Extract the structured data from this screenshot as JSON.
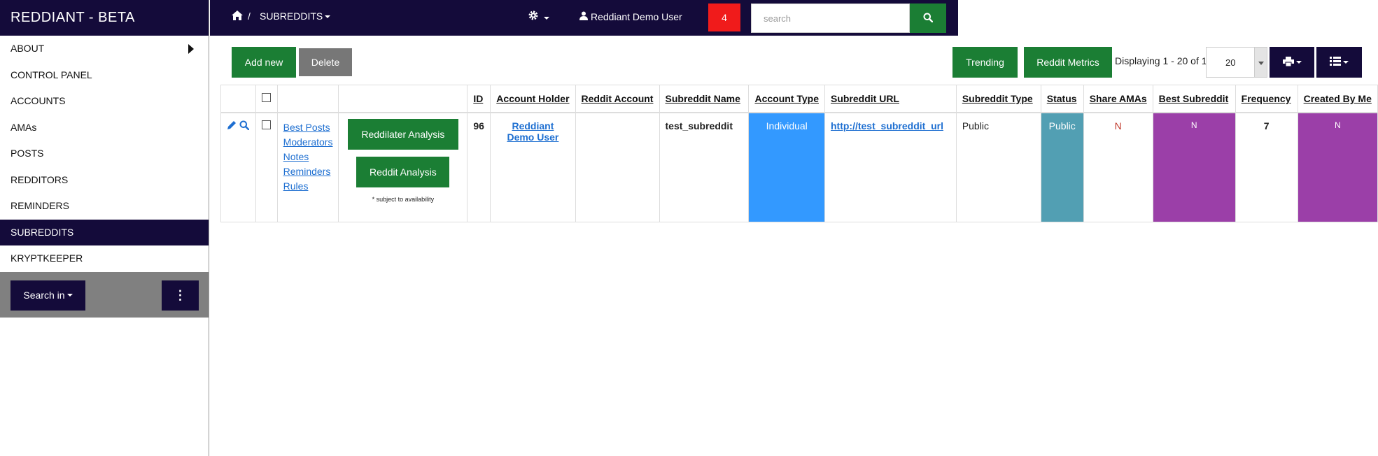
{
  "app": {
    "title": "REDDIANT - BETA"
  },
  "sidebar": {
    "items": [
      {
        "label": "ABOUT"
      },
      {
        "label": "CONTROL PANEL"
      },
      {
        "label": "ACCOUNTS"
      },
      {
        "label": "AMAs"
      },
      {
        "label": "POSTS"
      },
      {
        "label": "REDDITORS"
      },
      {
        "label": "REMINDERS"
      },
      {
        "label": "SUBREDDITS"
      },
      {
        "label": "KRYPTKEEPER"
      }
    ],
    "search_in_label": "Search in",
    "more_label": "⋮"
  },
  "topbar": {
    "breadcrumb_sep": "/",
    "breadcrumb": "SUBREDDITS",
    "user": "Reddiant Demo User",
    "notification_count": "4",
    "search_placeholder": "search"
  },
  "toolbar": {
    "add_new": "Add new",
    "delete": "Delete",
    "trending": "Trending",
    "reddit_metrics": "Reddit Metrics",
    "displaying": "Displaying 1 - 20 of 1",
    "page_size": "20"
  },
  "table": {
    "columns": {
      "id": "ID",
      "account_holder": "Account Holder",
      "reddit_account": "Reddit Account",
      "subreddit_name": "Subreddit Name",
      "account_type": "Account Type",
      "subreddit_url": "Subreddit URL",
      "subreddit_type": "Subreddit Type",
      "status": "Status",
      "share_amas": "Share AMAs",
      "best_subreddit": "Best Subreddit",
      "frequency": "Frequency",
      "created_by_me": "Created By Me"
    },
    "row": {
      "links": [
        "Best Posts",
        "Moderators",
        "Notes",
        "Reminders",
        "Rules"
      ],
      "reddilater_analysis": "Reddilater Analysis",
      "reddit_analysis": "Reddit Analysis",
      "availability_note": "* subject to availability",
      "id": "96",
      "account_holder_line1": "Reddiant",
      "account_holder_line2": "Demo User",
      "reddit_account": "",
      "subreddit_name": "test_subreddit",
      "account_type": "Individual",
      "subreddit_url": "http://test_subreddit_url",
      "subreddit_type": "Public",
      "status": "Public",
      "share_amas": "N",
      "best_subreddit": "N",
      "frequency": "7",
      "created_by_me": "N"
    }
  },
  "colors": {
    "navy": "#140b3a",
    "green": "#1b7e34",
    "red_badge": "#f01b1b",
    "account_type_bg": "#3399ff",
    "status_bg": "#529fb3",
    "purple_cell": "#9b3fa8",
    "share_amas_text": "#c0392b",
    "link": "#1e6fd1"
  }
}
